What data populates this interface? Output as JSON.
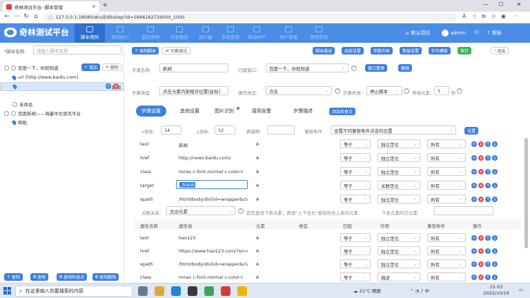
{
  "browser": {
    "tab_title": "奇林测试平台--脚本管理",
    "url": "127.0.0.1:18080/#/uiEdit/step?id=1666162726000_1000",
    "info_icon": "info-icon"
  },
  "header": {
    "logo_text": "奇林测试平台",
    "nav": [
      {
        "label": "脚本用例"
      },
      {
        "label": "测试执行"
      },
      {
        "label": "监控预测"
      },
      {
        "label": "历史报告"
      },
      {
        "label": "执行器"
      },
      {
        "label": "手机管理"
      },
      {
        "label": "移动APP"
      },
      {
        "label": "用户管理"
      },
      {
        "label": "项目管理"
      }
    ],
    "project": "默认项目",
    "user": "admin",
    "help": "帮助"
  },
  "left": {
    "script_name_label": "*脚本名称:",
    "script_name_placeholder": "请输入脚本名称",
    "add_label": "增加",
    "delete_label": "删除",
    "tree": [
      {
        "label": "百度一下，你就知道"
      },
      {
        "label": "url [http://www.baidu.com]"
      },
      {
        "label": "新闻"
      },
      {
        "label": "未命名"
      },
      {
        "label": "百度新闻——海量中文资讯平台"
      },
      {
        "label": "帮助"
      }
    ],
    "bottom_buttons": [
      "复制",
      "复制",
      "复制检查点",
      "复制删除"
    ]
  },
  "toolbar": {
    "record_label": "录制脚本",
    "switch_label": "切换调试",
    "buttons": [
      "脚本描述",
      "局部设置",
      "参数列表",
      "数据设置",
      "作为模板",
      "保存"
    ],
    "exit_label": "退出"
  },
  "form": {
    "step_name_label": "步骤名称:",
    "step_name_value": "新闻",
    "window_label": "归属窗口:",
    "window_value": "百度一下，你就知道",
    "window_mgr_label": "窗口管理",
    "screenshot_label": "截图",
    "step_type_label": "步骤类型:",
    "step_type_value": "点击元素内部相对位置[鼠标]",
    "op_type_label": "操作类型:",
    "op_type_value": "点击",
    "fail_label": "步骤失败:",
    "fail_value": "停止脚本",
    "wait_label": "等待元素:",
    "wait_value": "5",
    "wait_unit": "秒"
  },
  "subtabs": [
    "步骤设置",
    "其他设置",
    "图片识别",
    "接到告警",
    "步骤描述"
  ],
  "add_check_label": "添加检查点",
  "coords": {
    "x_label": "x坐标:",
    "x_value": "14",
    "y_label": "y坐标:",
    "y_value": "12",
    "offset_label": "再偏移:",
    "compat_label": "兼容条件:",
    "compat_value": "设置不同兼容条件点击的位置",
    "set_label": "设置"
  },
  "attrs_top": [
    {
      "name": "text",
      "value": "新闻",
      "elem": "A",
      "match": "等于",
      "act": "独立定位",
      "cond": "所有"
    },
    {
      "name": "href",
      "value": "http://news.baidu.com/",
      "elem": "A",
      "match": "等于",
      "act": "独立定位",
      "cond": "所有"
    },
    {
      "name": "class",
      "value": "mnav c-font-normal c-color-t",
      "elem": "A",
      "match": "等于",
      "act": "独立定位",
      "cond": "所有"
    },
    {
      "name": "target",
      "value": "_blank",
      "elem": "A",
      "match": "等于",
      "act": "关联定位",
      "cond": "所有"
    },
    {
      "name": "xpath",
      "value": "/html/body/div[id=wrapper&clas",
      "elem": "A",
      "match": "等于",
      "act": "独立定位",
      "cond": "所有"
    }
  ],
  "relation": {
    "label": "关联关系:",
    "value": "左边元素",
    "hint": "首先查找下表元素，再按\"上下左右\"查找符合上表的元素",
    "intersect_label": "下表元素的交元素:"
  },
  "table_headers": [
    "属性名称",
    "属性值",
    "元素",
    "类型",
    "匹配",
    "作用",
    "兼容条件",
    "操作"
  ],
  "attrs_bottom": [
    {
      "name": "text",
      "value": "hao123",
      "elem": "A",
      "match": "等于",
      "act": "独立定位",
      "cond": "所有"
    },
    {
      "name": "href",
      "value": "https://www.hao123.com/?src=",
      "elem": "A",
      "match": "等于",
      "act": "独立定位",
      "cond": "所有"
    },
    {
      "name": "xpath",
      "value": "/html/body/div[id=wrapper&clas",
      "elem": "A",
      "match": "等于",
      "act": "独立定位",
      "cond": "所有"
    },
    {
      "name": "class",
      "value": "mnav c-font-normal c-color-t",
      "elem": "A",
      "match": "等于",
      "act": "描述",
      "cond": "所有"
    }
  ],
  "taskbar": {
    "search_placeholder": "在这里输入你要搜索的内容",
    "weather": "21°C 晴朗",
    "time": "15:03",
    "date": "2022/10/19"
  },
  "colors": {
    "accent": "#3d7fe0",
    "header": "#4a8ce6",
    "danger": "#e6534b",
    "success": "#35b556"
  }
}
